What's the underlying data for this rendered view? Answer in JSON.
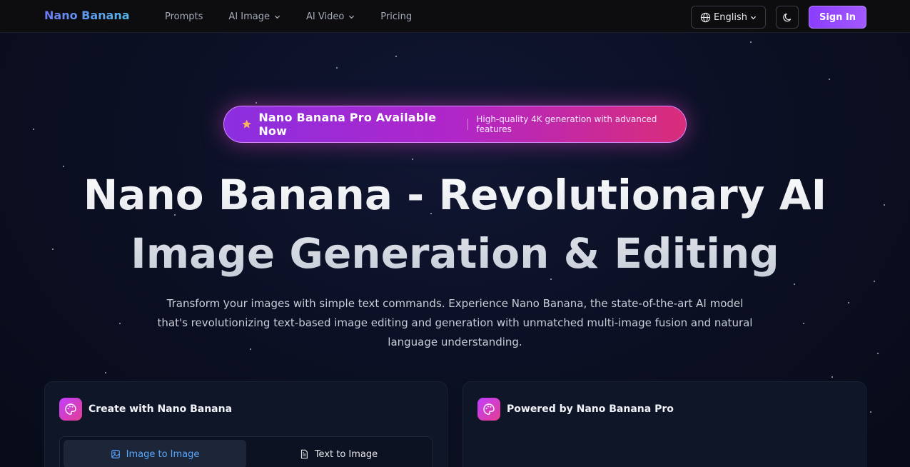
{
  "nav": {
    "brand": "Nano Banana",
    "links": [
      {
        "label": "Prompts"
      },
      {
        "label": "AI Image",
        "dropdown": true
      },
      {
        "label": "AI Video",
        "dropdown": true
      },
      {
        "label": "Pricing"
      }
    ],
    "language": "English",
    "signin": "Sign In"
  },
  "announcement": {
    "title": "Nano Banana Pro Available Now",
    "subtitle": "High-quality 4K generation with advanced features",
    "icon": "star-icon"
  },
  "hero": {
    "title": "Nano Banana - Revolutionary AI Image Generation & Editing",
    "description": "Transform your images with simple text commands. Experience Nano Banana, the state-of-the-art AI model that's revolutionizing text-based image editing and generation with unmatched multi-image fusion and natural language understanding."
  },
  "cards": {
    "left": {
      "title": "Create with Nano Banana",
      "icon": "palette-icon",
      "tabs": [
        {
          "label": "Image to Image",
          "icon": "image-icon",
          "active": true
        },
        {
          "label": "Text to Image",
          "icon": "document-icon",
          "active": false
        }
      ]
    },
    "right": {
      "title": "Powered by Nano Banana Pro",
      "icon": "palette-icon"
    }
  },
  "colors": {
    "accent": "#8b3dff",
    "pill_start": "#8b2fe0",
    "pill_end": "#d92d7a",
    "active_tab_text": "#5aa8ff"
  }
}
